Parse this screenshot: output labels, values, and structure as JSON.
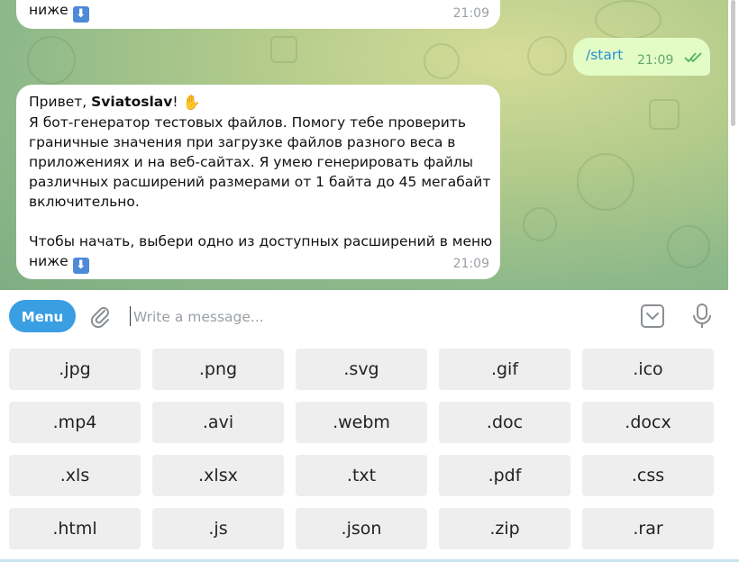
{
  "chat": {
    "prev_message": {
      "text": "ниже",
      "time": "21:09"
    },
    "outgoing": {
      "command": "/start",
      "time": "21:09"
    },
    "bot_message": {
      "greeting_prefix": "Привет, ",
      "user_name": "Sviatoslav",
      "greeting_suffix": "!",
      "lines": [
        "Я бот-генератор тестовых файлов. Помогу тебе проверить",
        "граничные значения при загрузке файлов разного веса в",
        "приложениях и на веб-сайтах. Я умею генерировать файлы",
        "различных расширений размерами от 1 байта до 45 мегабайт",
        "включительно."
      ],
      "closing_line": "Чтобы начать, выбери одно из доступных расширений в меню",
      "closing_tail": "ниже",
      "time": "21:09"
    }
  },
  "composer": {
    "menu_label": "Menu",
    "placeholder": "Write a message..."
  },
  "keyboard": {
    "rows": [
      [
        ".jpg",
        ".png",
        ".svg",
        ".gif",
        ".ico"
      ],
      [
        ".mp4",
        ".avi",
        ".webm",
        ".doc",
        ".docx"
      ],
      [
        ".xls",
        ".xlsx",
        ".txt",
        ".pdf",
        ".css"
      ],
      [
        ".html",
        ".js",
        ".json",
        ".zip",
        ".rar"
      ]
    ]
  },
  "icons": {
    "emoji_down": "down-arrow-button-emoji",
    "emoji_wave": "waving-hand-emoji",
    "read_receipt": "double-check-icon",
    "attach": "paperclip-icon",
    "keyboard_toggle": "keyboard-chevron-icon",
    "mic": "microphone-icon"
  },
  "colors": {
    "menu_button": "#3a9ee3",
    "outgoing_bubble": "#e3fcc6",
    "command_link": "#2b8fd6",
    "key_background": "#eeeeee"
  }
}
